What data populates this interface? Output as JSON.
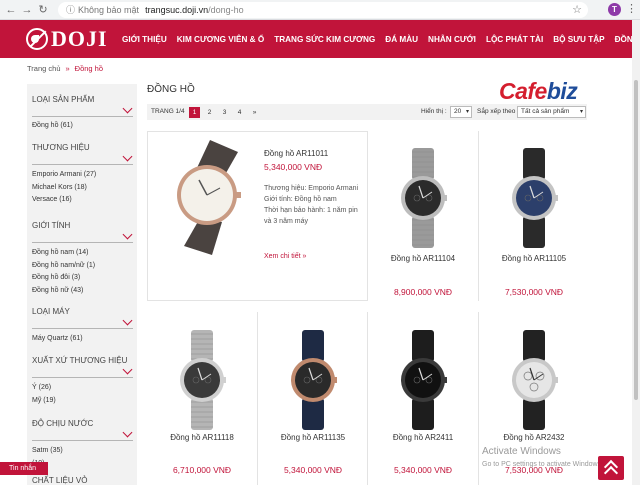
{
  "browser": {
    "security_label": "Không bảo mật",
    "url_host": "trangsuc.doji.vn",
    "url_path": "/dong-ho",
    "profile_initial": "T"
  },
  "site": {
    "logo_text": "DOJI",
    "nav": [
      "GIỚI THIỆU",
      "KIM CƯƠNG VIÊN & Ổ",
      "TRANG SỨC KIM CƯƠNG",
      "ĐÁ MÀU",
      "NHẪN CƯỚI",
      "LỘC PHÁT TÀI",
      "BỘ SƯU TẬP",
      "ĐỒNG HỒ"
    ],
    "brand_color": "#c1143a"
  },
  "breadcrumb": {
    "home": "Trang chủ",
    "separator": "»",
    "current": "Đồng hồ"
  },
  "sidebar": {
    "groups": [
      {
        "title": "LOẠI SẢN PHẨM",
        "items": [
          "Đồng hồ (61)"
        ]
      },
      {
        "title": "THƯƠNG HIỆU",
        "items": [
          "Emporio Armani (27)",
          "Michael Kors (18)",
          "Versace (16)"
        ]
      },
      {
        "title": "GIỚI TÍNH",
        "items": [
          "Đồng hồ nam (14)",
          "Đồng hồ nam/nữ (1)",
          "Đồng hồ đôi (3)",
          "Đồng hồ nữ (43)"
        ]
      },
      {
        "title": "LOẠI MÁY",
        "items": [
          "Máy Quartz (61)"
        ]
      },
      {
        "title": "XUẤT XỨ THƯƠNG HIỆU",
        "items": [
          "Ý (26)",
          "Mỹ (19)"
        ]
      },
      {
        "title": "ĐỘ CHỊU NƯỚC",
        "items": [
          "Satm (35)",
          "(10)"
        ]
      },
      {
        "title": "CHẤT LIỆU VỎ",
        "items": []
      }
    ]
  },
  "content": {
    "title": "ĐỒNG HỒ",
    "watermark": {
      "part1": "Cafe",
      "part2": "biz"
    },
    "page_info": "TRANG 1/4",
    "pages": [
      "1",
      "2",
      "3",
      "4",
      "»"
    ],
    "active_page": "1",
    "show_label": "Hiển thị :",
    "show_value": "20",
    "sort_label": "Sắp xếp theo :",
    "sort_value": "Tất cả sản phẩm"
  },
  "featured": {
    "name": "Đồng hồ AR11011",
    "price": "5,340,000 VNĐ",
    "details": [
      "Thương hiệu: Emporio Armani",
      "Giới tính: Đồng hồ nam",
      "Thời hạn bảo hành: 1 năm pin",
      "và 3 năm máy"
    ],
    "more": "Xem chi tiết »"
  },
  "products": [
    {
      "name": "Đồng hồ AR11104",
      "price": "8,900,000 VNĐ",
      "style": "mesh"
    },
    {
      "name": "Đồng hồ AR11105",
      "price": "7,530,000 VNĐ",
      "style": "blue-leather"
    },
    {
      "name": "Đồng hồ AR11118",
      "price": "6,710,000 VNĐ",
      "style": "steel"
    },
    {
      "name": "Đồng hồ AR11135",
      "price": "5,340,000 VNĐ",
      "style": "rose-navy"
    },
    {
      "name": "Đồng hồ AR2411",
      "price": "5,340,000 VNĐ",
      "style": "black-leather"
    },
    {
      "name": "Đồng hồ AR2432",
      "price": "7,530,000 VNĐ",
      "style": "silver-chrono"
    }
  ],
  "chat_label": "Tin nhắn",
  "activation": {
    "title": "Activate Windows",
    "subtitle": "Go to PC settings to activate Windows."
  }
}
